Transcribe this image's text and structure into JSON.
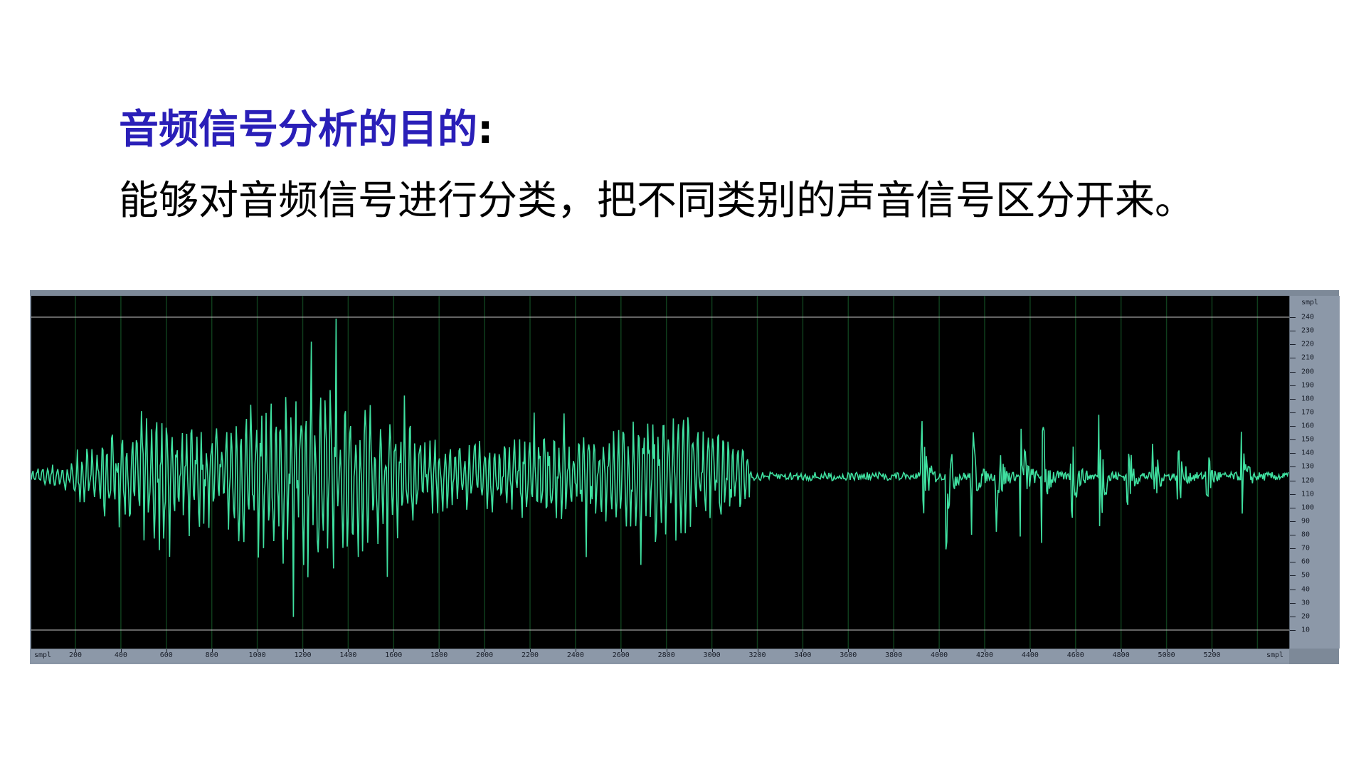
{
  "heading": {
    "title": "音频信号分析的目的",
    "colon": ":"
  },
  "subtitle": "能够对音频信号进行分类，把不同类别的声音信号区分开来。",
  "waveform": {
    "y_unit_label": "smpl",
    "y_ticks": [
      "240",
      "230",
      "220",
      "210",
      "200",
      "190",
      "180",
      "170",
      "160",
      "150",
      "140",
      "130",
      "120",
      "110",
      "100",
      "90",
      "80",
      "70",
      "60",
      "50",
      "40",
      "30",
      "20",
      "10"
    ],
    "x_start_label": "smpl",
    "x_ticks": [
      "200",
      "400",
      "600",
      "800",
      "1000",
      "1200",
      "1400",
      "1600",
      "1800",
      "2000",
      "2200",
      "2400",
      "2600",
      "2800",
      "3000",
      "3200",
      "3400",
      "3600",
      "3800",
      "4000",
      "4200",
      "4400",
      "4600",
      "4800",
      "5000",
      "5200"
    ],
    "x_end_label": "smpl",
    "colors": {
      "background": "#000000",
      "grid": "#0f3d1c",
      "wave": "#3fe0a0",
      "bounds": "#c8c8c8"
    }
  }
}
